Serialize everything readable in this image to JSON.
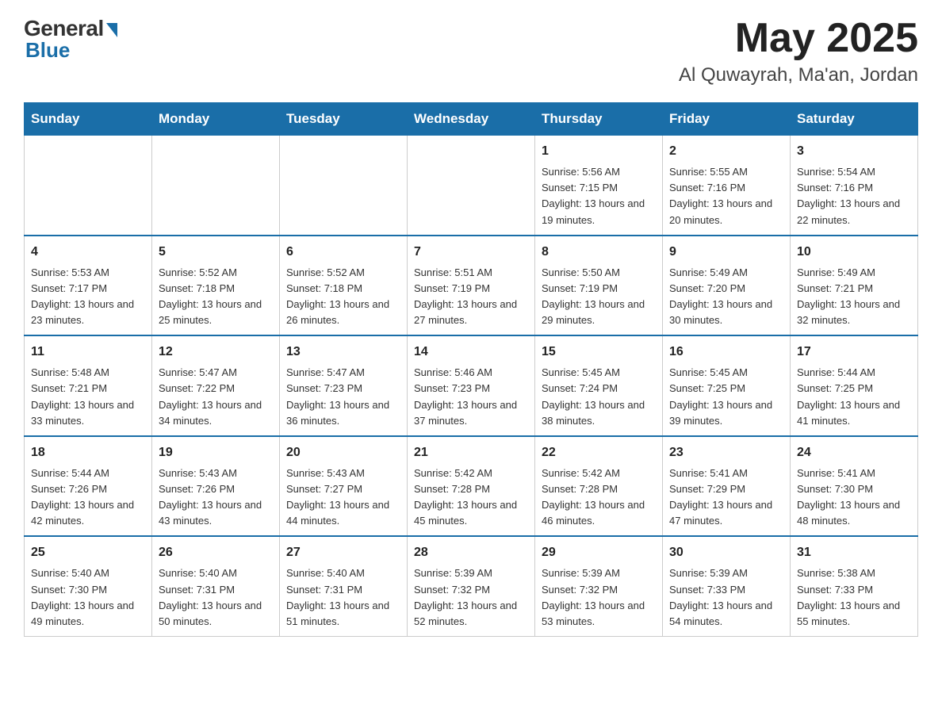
{
  "logo": {
    "general": "General",
    "blue": "Blue"
  },
  "title": {
    "month_year": "May 2025",
    "location": "Al Quwayrah, Ma'an, Jordan"
  },
  "days_of_week": [
    "Sunday",
    "Monday",
    "Tuesday",
    "Wednesday",
    "Thursday",
    "Friday",
    "Saturday"
  ],
  "weeks": [
    [
      {
        "day": "",
        "info": ""
      },
      {
        "day": "",
        "info": ""
      },
      {
        "day": "",
        "info": ""
      },
      {
        "day": "",
        "info": ""
      },
      {
        "day": "1",
        "info": "Sunrise: 5:56 AM\nSunset: 7:15 PM\nDaylight: 13 hours and 19 minutes."
      },
      {
        "day": "2",
        "info": "Sunrise: 5:55 AM\nSunset: 7:16 PM\nDaylight: 13 hours and 20 minutes."
      },
      {
        "day": "3",
        "info": "Sunrise: 5:54 AM\nSunset: 7:16 PM\nDaylight: 13 hours and 22 minutes."
      }
    ],
    [
      {
        "day": "4",
        "info": "Sunrise: 5:53 AM\nSunset: 7:17 PM\nDaylight: 13 hours and 23 minutes."
      },
      {
        "day": "5",
        "info": "Sunrise: 5:52 AM\nSunset: 7:18 PM\nDaylight: 13 hours and 25 minutes."
      },
      {
        "day": "6",
        "info": "Sunrise: 5:52 AM\nSunset: 7:18 PM\nDaylight: 13 hours and 26 minutes."
      },
      {
        "day": "7",
        "info": "Sunrise: 5:51 AM\nSunset: 7:19 PM\nDaylight: 13 hours and 27 minutes."
      },
      {
        "day": "8",
        "info": "Sunrise: 5:50 AM\nSunset: 7:19 PM\nDaylight: 13 hours and 29 minutes."
      },
      {
        "day": "9",
        "info": "Sunrise: 5:49 AM\nSunset: 7:20 PM\nDaylight: 13 hours and 30 minutes."
      },
      {
        "day": "10",
        "info": "Sunrise: 5:49 AM\nSunset: 7:21 PM\nDaylight: 13 hours and 32 minutes."
      }
    ],
    [
      {
        "day": "11",
        "info": "Sunrise: 5:48 AM\nSunset: 7:21 PM\nDaylight: 13 hours and 33 minutes."
      },
      {
        "day": "12",
        "info": "Sunrise: 5:47 AM\nSunset: 7:22 PM\nDaylight: 13 hours and 34 minutes."
      },
      {
        "day": "13",
        "info": "Sunrise: 5:47 AM\nSunset: 7:23 PM\nDaylight: 13 hours and 36 minutes."
      },
      {
        "day": "14",
        "info": "Sunrise: 5:46 AM\nSunset: 7:23 PM\nDaylight: 13 hours and 37 minutes."
      },
      {
        "day": "15",
        "info": "Sunrise: 5:45 AM\nSunset: 7:24 PM\nDaylight: 13 hours and 38 minutes."
      },
      {
        "day": "16",
        "info": "Sunrise: 5:45 AM\nSunset: 7:25 PM\nDaylight: 13 hours and 39 minutes."
      },
      {
        "day": "17",
        "info": "Sunrise: 5:44 AM\nSunset: 7:25 PM\nDaylight: 13 hours and 41 minutes."
      }
    ],
    [
      {
        "day": "18",
        "info": "Sunrise: 5:44 AM\nSunset: 7:26 PM\nDaylight: 13 hours and 42 minutes."
      },
      {
        "day": "19",
        "info": "Sunrise: 5:43 AM\nSunset: 7:26 PM\nDaylight: 13 hours and 43 minutes."
      },
      {
        "day": "20",
        "info": "Sunrise: 5:43 AM\nSunset: 7:27 PM\nDaylight: 13 hours and 44 minutes."
      },
      {
        "day": "21",
        "info": "Sunrise: 5:42 AM\nSunset: 7:28 PM\nDaylight: 13 hours and 45 minutes."
      },
      {
        "day": "22",
        "info": "Sunrise: 5:42 AM\nSunset: 7:28 PM\nDaylight: 13 hours and 46 minutes."
      },
      {
        "day": "23",
        "info": "Sunrise: 5:41 AM\nSunset: 7:29 PM\nDaylight: 13 hours and 47 minutes."
      },
      {
        "day": "24",
        "info": "Sunrise: 5:41 AM\nSunset: 7:30 PM\nDaylight: 13 hours and 48 minutes."
      }
    ],
    [
      {
        "day": "25",
        "info": "Sunrise: 5:40 AM\nSunset: 7:30 PM\nDaylight: 13 hours and 49 minutes."
      },
      {
        "day": "26",
        "info": "Sunrise: 5:40 AM\nSunset: 7:31 PM\nDaylight: 13 hours and 50 minutes."
      },
      {
        "day": "27",
        "info": "Sunrise: 5:40 AM\nSunset: 7:31 PM\nDaylight: 13 hours and 51 minutes."
      },
      {
        "day": "28",
        "info": "Sunrise: 5:39 AM\nSunset: 7:32 PM\nDaylight: 13 hours and 52 minutes."
      },
      {
        "day": "29",
        "info": "Sunrise: 5:39 AM\nSunset: 7:32 PM\nDaylight: 13 hours and 53 minutes."
      },
      {
        "day": "30",
        "info": "Sunrise: 5:39 AM\nSunset: 7:33 PM\nDaylight: 13 hours and 54 minutes."
      },
      {
        "day": "31",
        "info": "Sunrise: 5:38 AM\nSunset: 7:33 PM\nDaylight: 13 hours and 55 minutes."
      }
    ]
  ]
}
